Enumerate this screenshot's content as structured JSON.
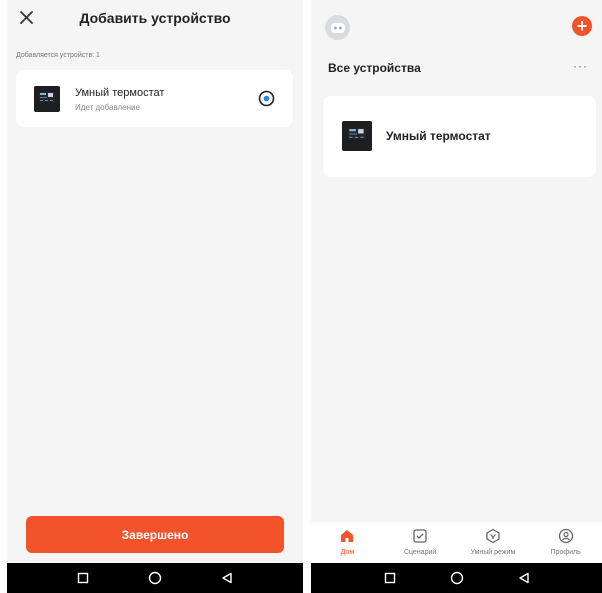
{
  "add_screen": {
    "title": "Добавить устройство",
    "adding_count": "Добавляется устройств: 1",
    "device": {
      "name": "Умный термостат",
      "status": "Идет добавление"
    },
    "done_button": "Завершено"
  },
  "home_screen": {
    "section_title": "Все устройства",
    "more": "···",
    "device": {
      "name": "Умный термостат"
    },
    "tabs": [
      {
        "label": "Дом",
        "icon": "home-icon",
        "active": true
      },
      {
        "label": "Сценарий",
        "icon": "scenario-icon",
        "active": false
      },
      {
        "label": "Умный режим",
        "icon": "smart-mode-icon",
        "active": false
      },
      {
        "label": "Профиль",
        "icon": "profile-icon",
        "active": false
      }
    ]
  },
  "colors": {
    "accent": "#f3532b",
    "background": "#f5f5f6",
    "card": "#ffffff"
  }
}
